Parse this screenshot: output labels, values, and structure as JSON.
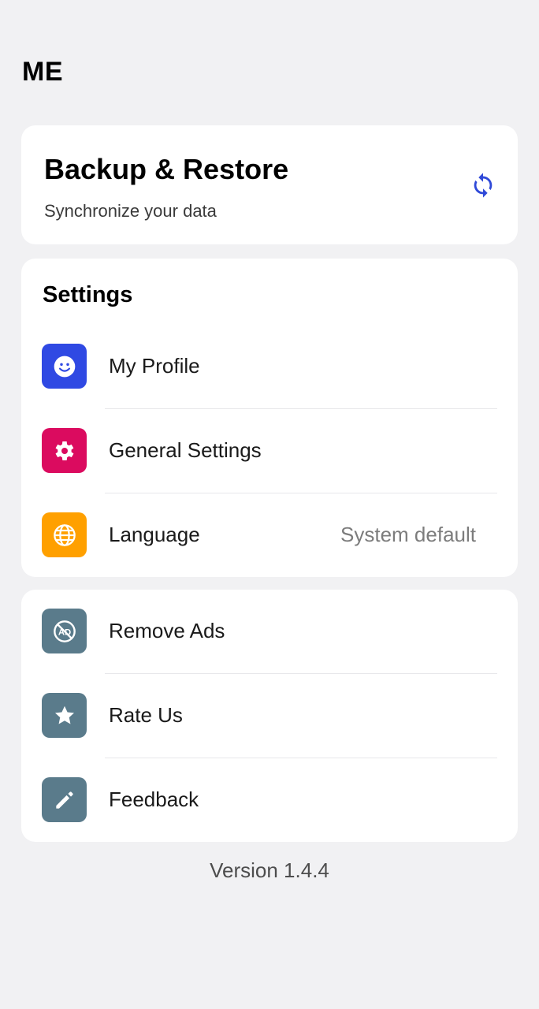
{
  "header": {
    "title": "ME"
  },
  "backup": {
    "title": "Backup & Restore",
    "subtitle": "Synchronize your data",
    "icon": "sync-icon",
    "icon_color": "#2f49d8"
  },
  "settings": {
    "title": "Settings",
    "items": [
      {
        "label": "My Profile",
        "icon": "smiley-icon",
        "color": "#2f49e3"
      },
      {
        "label": "General Settings",
        "icon": "gear-icon",
        "color": "#db0b5f"
      },
      {
        "label": "Language",
        "icon": "globe-icon",
        "color": "#ffa000",
        "value": "System default"
      }
    ]
  },
  "extras": {
    "items": [
      {
        "label": "Remove Ads",
        "icon": "no-ads-icon",
        "color": "#5a7b8b"
      },
      {
        "label": "Rate Us",
        "icon": "star-icon",
        "color": "#5a7b8b"
      },
      {
        "label": "Feedback",
        "icon": "pencil-icon",
        "color": "#5a7b8b"
      }
    ]
  },
  "footer": {
    "version": "Version 1.4.4"
  }
}
